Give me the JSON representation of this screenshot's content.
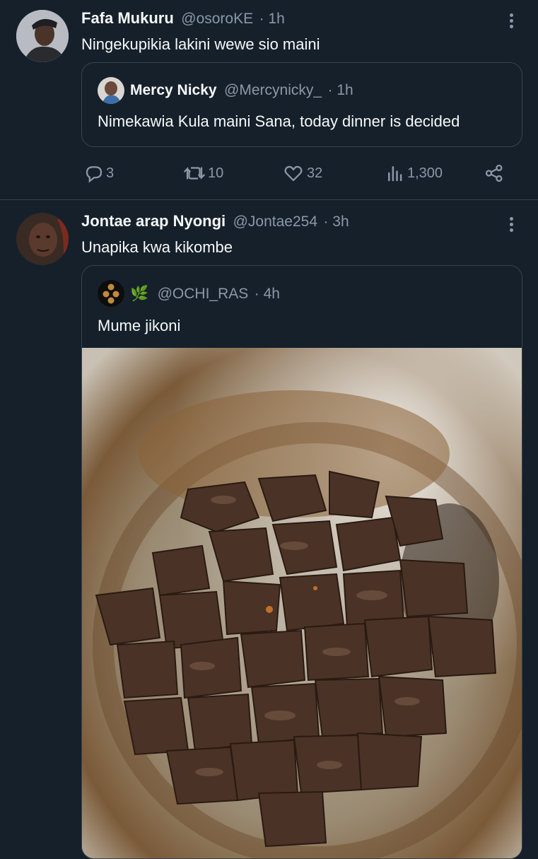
{
  "tweets": [
    {
      "author_name": "Fafa Mukuru",
      "author_handle": "@osoroKE",
      "time": "· 1h",
      "text": "Ningekupikia lakini wewe sio maini",
      "quote": {
        "author_name": "Mercy Nicky",
        "author_handle": "@Mercynicky_",
        "time": "· 1h",
        "text": "Nimekawia Kula maini Sana, today dinner is decided"
      },
      "stats": {
        "replies": "3",
        "retweets": "10",
        "likes": "32",
        "views": "1,300"
      }
    },
    {
      "author_name": "Jontae arap Nyongi",
      "author_handle": "@Jontae254",
      "time": "· 3h",
      "text": "Unapika kwa kikombe",
      "quote": {
        "author_emoji": "🌿",
        "author_handle": "@OCHI_RAS",
        "time": "· 4h",
        "text": "Mume jikoni",
        "media": "photo-of-cooked-liver-in-pot"
      }
    }
  ],
  "colors": {
    "background": "#15202b",
    "text": "#f7f9f9",
    "muted": "#8b98a5",
    "border": "#38444d"
  }
}
